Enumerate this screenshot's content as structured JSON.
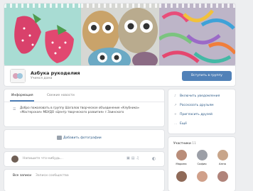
{
  "group": {
    "title": "Азбука рукоделия",
    "type": "Учимся дома",
    "join_label": "Вступить в группу"
  },
  "tabs": {
    "info": "Информация",
    "other": "Свежие новости"
  },
  "description": "Добро пожаловать в группу Шагалов творческое объединение «Клубника» «Мастерская» МБУДО «Центр творческого развития» г.Заинского",
  "photo": {
    "add_label": "Добавить фотографии"
  },
  "post": {
    "placeholder": "Напишите что-нибудь..."
  },
  "wall": {
    "all": "Все записи",
    "community": "Записи сообщества"
  },
  "actions": [
    {
      "icon": "bell-icon",
      "label": "Включить уведомления"
    },
    {
      "icon": "share-icon",
      "label": "Рассказать друзьям"
    },
    {
      "icon": "add-friend-icon",
      "label": "Пригласить друзей"
    },
    {
      "icon": "more-icon",
      "label": "Ещё"
    }
  ],
  "members": {
    "title": "Участники",
    "count": "11",
    "list": [
      {
        "name": "Марина",
        "color": "#b98d79"
      },
      {
        "name": "София",
        "color": "#9c9fa7"
      },
      {
        "name": "Анна",
        "color": "#c8a58a"
      },
      {
        "name": "",
        "color": "#8f6a58"
      },
      {
        "name": "",
        "color": "#d0a08a"
      },
      {
        "name": "",
        "color": "#b0837a"
      }
    ]
  },
  "colors": {
    "accent": "#5181b8",
    "link": "#2a5885",
    "background": "#edeef0"
  }
}
